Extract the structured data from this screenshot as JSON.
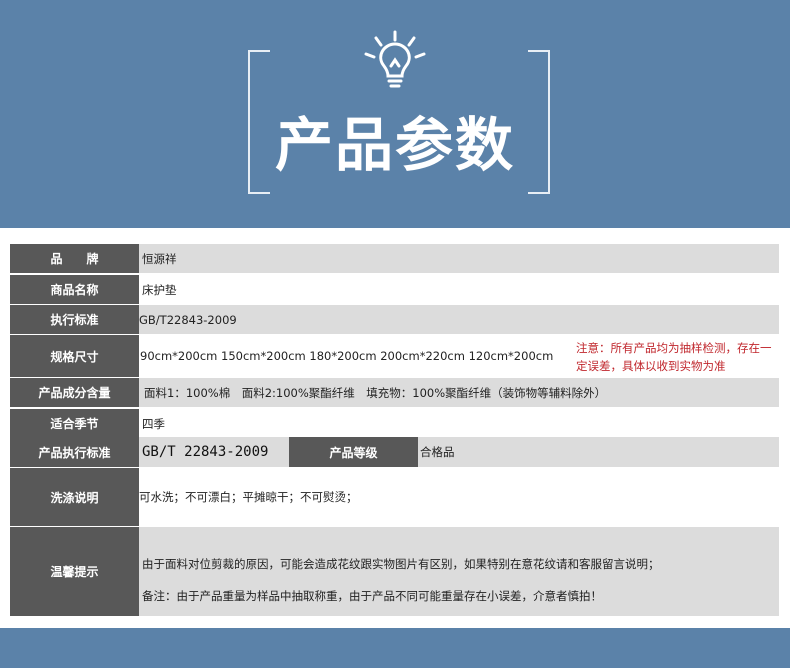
{
  "banner": {
    "title": "产品参数",
    "icon": "lightbulb-icon",
    "background": "#5b82a9"
  },
  "colors": {
    "label_bg": "#585858",
    "value_bg": "#dcdcdc",
    "note_text": "#c0272d"
  },
  "rows": {
    "brand": {
      "label": "品　　牌",
      "value": "恒源祥"
    },
    "product_name": {
      "label": "商品名称",
      "value": "床护垫"
    },
    "standard": {
      "label": "执行标准",
      "value": "GB/T22843-2009"
    },
    "size": {
      "label": "规格尺寸",
      "value": "90cm*200cm 150cm*200cm 180*200cm 200cm*220cm 120cm*200cm",
      "note": "注意：所有产品均为抽样检测，存在一定误差，具体以收到实物为准"
    },
    "composition": {
      "label": "产品成分含量",
      "value": "面料1：100%棉　面料2:100%聚酯纤维　填充物：100%聚酯纤维（装饰物等辅料除外）"
    },
    "season": {
      "label": "适合季节",
      "value": "四季"
    },
    "product_standard": {
      "label": "产品执行标准",
      "value": "GB/T 22843-2009",
      "grade_label": "产品等级",
      "grade_value": "合格品"
    },
    "washing": {
      "label": "洗涤说明",
      "value": "可水洗；不可漂白；平摊晾干；不可熨烫；"
    },
    "tips": {
      "label": "温馨提示",
      "line1": "由于面料对位剪裁的原因，可能会造成花纹跟实物图片有区别，如果特别在意花纹请和客服留言说明；",
      "line2": "备注：由于产品重量为样品中抽取称重，由于产品不同可能重量存在小误差，介意者慎拍！"
    }
  }
}
